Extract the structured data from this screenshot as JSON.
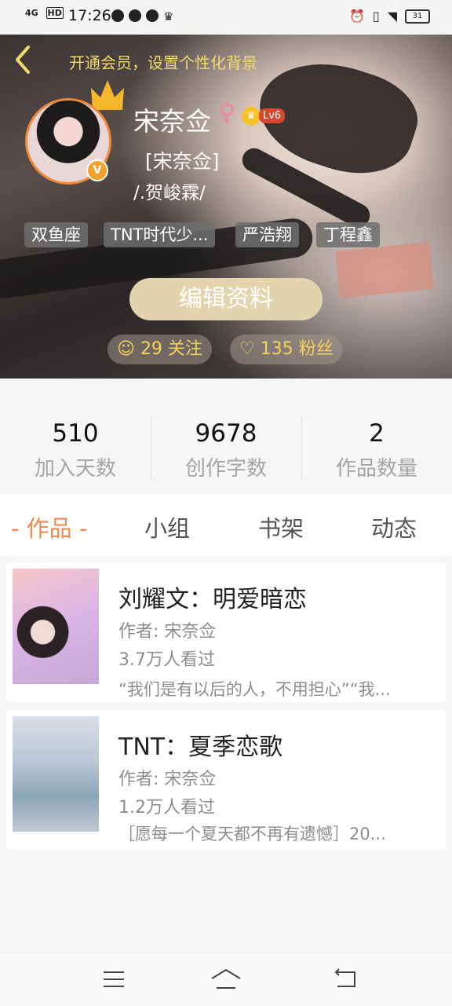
{
  "status_bar": {
    "network": "4G",
    "hd": "HD",
    "time": "17:26",
    "battery": "31"
  },
  "header": {
    "vip_prompt": "开通会员，设置个性化背景",
    "name": "宋奈佥",
    "gender_symbol": "♀",
    "level": "Lv6",
    "tagline": "[宋奈佥]",
    "signature": "/.贺峻霖/",
    "tags": [
      "双鱼座",
      "TNT时代少...",
      "严浩翔",
      "丁程鑫"
    ],
    "edit_button": "编辑资料",
    "following": "29 关注",
    "followers": "135 粉丝",
    "badge_letter": "V"
  },
  "stats": [
    {
      "value": "510",
      "label": "加入天数"
    },
    {
      "value": "9678",
      "label": "创作字数"
    },
    {
      "value": "2",
      "label": "作品数量"
    }
  ],
  "tabs": [
    "- 作品 -",
    "小组",
    "书架",
    "动态"
  ],
  "works": [
    {
      "title": "刘耀文：明爱暗恋",
      "author": "作者: 宋奈佥",
      "views": "3.7万人看过",
      "desc": "“我们是有以后的人，不用担心”“我..."
    },
    {
      "title": "TNT：夏季恋歌",
      "author": "作者: 宋奈佥",
      "views": "1.2万人看过",
      "desc": "［愿每一个夏天都不再有遗憾］20..."
    }
  ],
  "colors": {
    "accent": "#ee8a4f",
    "vip_gold": "#f2d96a",
    "level_red": "#d9472f"
  }
}
